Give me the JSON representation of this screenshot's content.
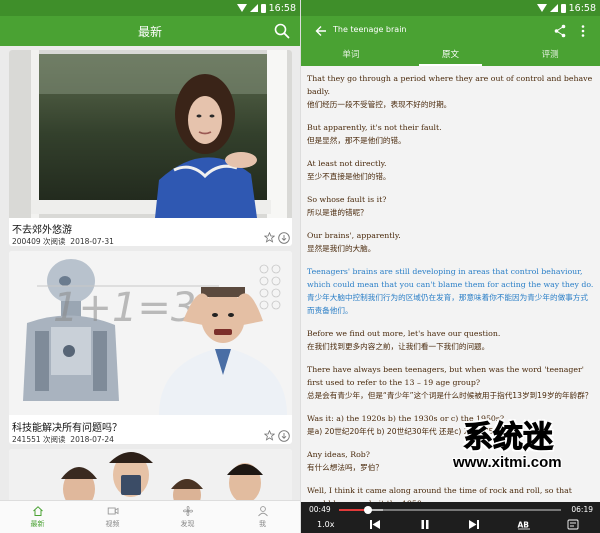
{
  "status": {
    "time": "16:58"
  },
  "left": {
    "appbar_title": "最新",
    "cards": [
      {
        "title": "不去郊外悠游",
        "views": "200409 次阅读",
        "date": "2018-07-31"
      },
      {
        "title": "科技能解决所有问题吗？",
        "views": "241551 次阅读",
        "date": "2018-07-24"
      }
    ],
    "nav": [
      {
        "label": "最新",
        "icon": "home-icon"
      },
      {
        "label": "视频",
        "icon": "video-icon"
      },
      {
        "label": "发现",
        "icon": "discover-icon"
      },
      {
        "label": "我",
        "icon": "profile-icon"
      }
    ],
    "nav_active": 0,
    "accent": "#4aa233"
  },
  "right": {
    "title": "The teenage brain",
    "tabs": [
      "单词",
      "原文",
      "评测"
    ],
    "active_tab": 1,
    "paragraphs": [
      {
        "en": "That they go through a period where they are out of control and behave badly.",
        "zh": "他们经历一段不受管控，表现不好的时期。"
      },
      {
        "en": "But apparently, it's not their fault.",
        "zh": "但是显然，那不是他们的错。"
      },
      {
        "en": "At least not directly.",
        "zh": "至少不直接是他们的错。"
      },
      {
        "en": "So whose fault is it?",
        "zh": "所以是谁的错呢？"
      },
      {
        "en": "Our brains', apparently.",
        "zh": "显然是我们的大脑。"
      },
      {
        "en": "Teenagers' brains are still developing in areas that control behaviour, which could mean that you can't blame them for acting the way they do.",
        "zh": "青少年大脑中控制我们行为的区域仍在发育，那意味着你不能因为青少年的做事方式而责备他们。",
        "highlight": true
      },
      {
        "en": "Before we find out more, let's have our question.",
        "zh": "在我们找到更多内容之前，让我们看一下我们的问题。"
      },
      {
        "en": "There have always been teenagers, but when was the word 'teenager' first used to refer to the 13 – 19 age group?",
        "zh": "总是会有青少年，但是“青少年”这个词是什么时候被用于指代13岁到19岁的年龄群？"
      },
      {
        "en": "Was it: a) the 1920s b) the 1930s or c) the 1950s?",
        "zh": "是a) 20世纪20年代 b) 20世纪30年代 还是c) 20世纪50年代？"
      },
      {
        "en": "Any ideas, Rob?",
        "zh": "有什么想法吗，罗伯？"
      },
      {
        "en": "Well, I think it came along around the time of rock and roll, so that would have made it the 1950s.",
        "zh": ""
      }
    ],
    "player": {
      "current": "00:49",
      "duration": "06:19",
      "speed": "1.0x",
      "progress": 0.129,
      "buffered": 0.2
    },
    "accent": "#4aa233",
    "highlight_color": "#2b7fc7",
    "text_color": "#4a2a0c"
  },
  "watermark": {
    "logo": "系统迷",
    "url": "www.xitmi.com"
  }
}
